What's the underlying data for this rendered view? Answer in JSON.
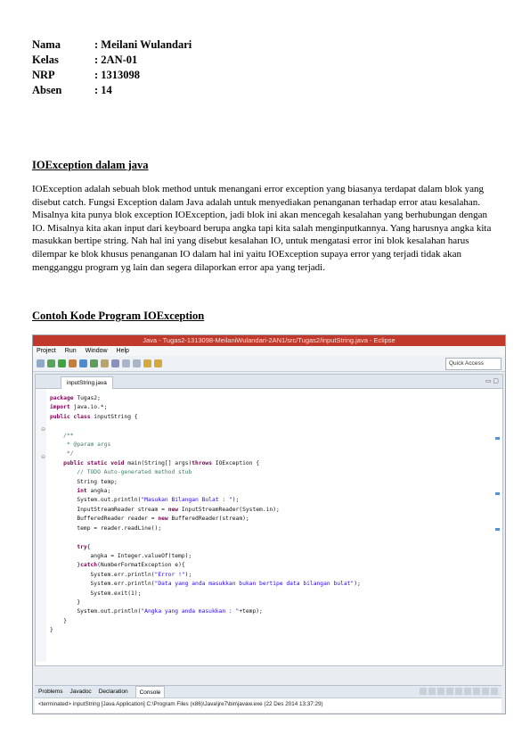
{
  "header": {
    "rows": [
      {
        "key": "Nama",
        "value": ": Meilani Wulandari"
      },
      {
        "key": "Kelas",
        "value": ": 2AN-01"
      },
      {
        "key": "NRP",
        "value": ": 1313098"
      },
      {
        "key": "Absen",
        "value": ": 14"
      }
    ]
  },
  "section1": {
    "title": "IOException dalam java",
    "body": "IOException adalah sebuah blok method untuk menangani error exception yang biasanya terdapat dalam blok yang disebut catch. Fungsi Exception dalam Java adalah untuk menyediakan penanganan terhadap error atau kesalahan. Misalnya kita punya blok exception IOException, jadi blok ini akan mencegah kesalahan yang berhubungan dengan IO. Misalnya kita akan input dari keyboard berupa angka tapi kita salah menginputkannya. Yang harusnya angka kita masukkan bertipe string. Nah hal ini yang disebut kesalahan IO, untuk mengatasi error ini blok kesalahan harus dilempar ke blok khusus penanganan IO dalam hal ini yaitu IOException supaya error yang terjadi tidak akan mengganggu program yg lain dan segera dilaporkan error apa yang terjadi."
  },
  "section2": {
    "title": "Contoh Kode Program IOException"
  },
  "ide": {
    "window_title": "Java - Tugas2-1313098-MeilaniWulandari-2AN1/src/Tugas2/inputString.java - Eclipse",
    "menu": [
      "Project",
      "Run",
      "Window",
      "Help"
    ],
    "quick_access": "Quick Access",
    "editor_tab": "inputString.java",
    "code_lines": [
      "package Tugas2;",
      "import java.io.*;",
      "public class inputString {",
      "",
      "    /**",
      "     * @param args",
      "     */",
      "    public static void main(String[] args)throws IOException {",
      "        // TODO Auto-generated method stub",
      "        String temp;",
      "        int angka;",
      "        System.out.println(\"Masukan Bilangan Bulat : \");",
      "        InputStreamReader stream = new InputStreamReader(System.in);",
      "        BufferedReader reader = new BufferedReader(stream);",
      "        temp = reader.readLine();",
      "",
      "        try{",
      "            angka = Integer.valueOf(temp);",
      "        }catch(NumberFormatException e){",
      "            System.err.println(\"Error !\");",
      "            System.err.println(\"Data yang anda masukkan bukan bertipe data bilangan bulat\");",
      "            System.exit(1);",
      "        }",
      "        System.out.println(\"Angka yang anda masukkan : \"+temp);",
      "    }",
      "}"
    ],
    "console_tabs": [
      "Problems",
      "Javadoc",
      "Declaration",
      "Console"
    ],
    "console_status": "<terminated> inputString [Java Application] C:\\Program Files (x86)\\Java\\jre7\\bin\\javaw.exe (22 Des 2014 13:37:29)"
  }
}
